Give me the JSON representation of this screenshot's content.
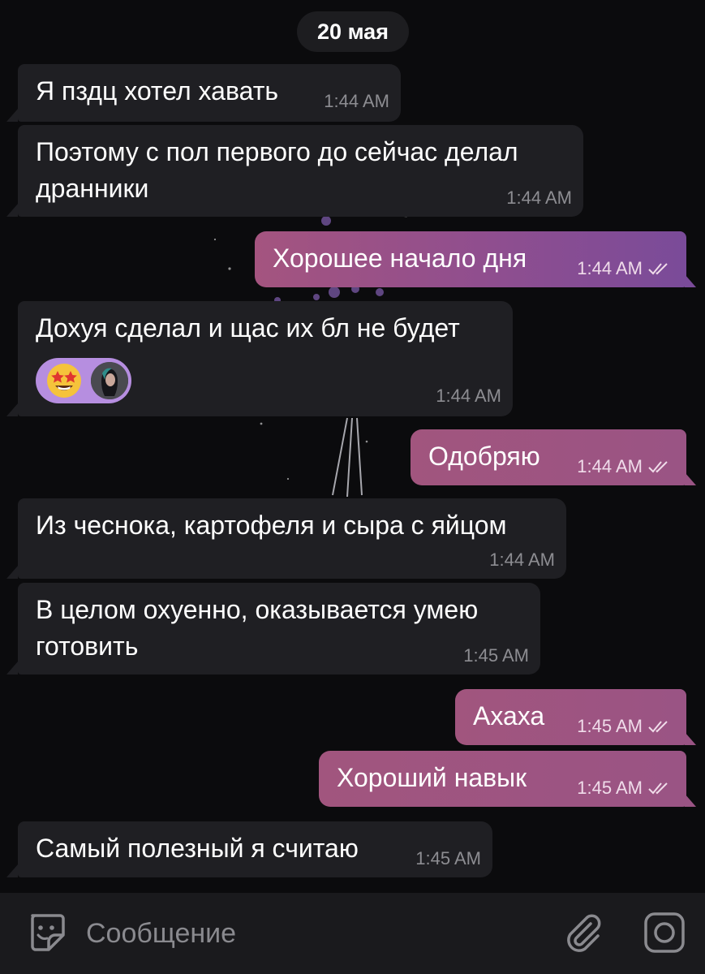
{
  "date_separator": "20 мая",
  "messages": [
    {
      "direction": "in",
      "lines": [
        "Я пздц хотел хавать"
      ],
      "time": "1:44 AM"
    },
    {
      "direction": "in",
      "lines": [
        "Поэтому с пол первого до сейчас делал",
        "дранники"
      ],
      "time": "1:44 AM"
    },
    {
      "direction": "out",
      "lines": [
        "Хорошее начало дня"
      ],
      "time": "1:44 AM",
      "status": "read"
    },
    {
      "direction": "in",
      "lines": [
        "Дохуя сделал и щас их бл не будет"
      ],
      "time": "1:44 AM",
      "reaction": {
        "emoji": "star-struck-emoji",
        "by": "user-avatar"
      }
    },
    {
      "direction": "out",
      "lines": [
        "Одобряю"
      ],
      "time": "1:44 AM",
      "status": "read"
    },
    {
      "direction": "in",
      "lines": [
        "Из чеснока, картофеля и сыра с яйцом"
      ],
      "time": "1:44 AM"
    },
    {
      "direction": "in",
      "lines": [
        "В целом охуенно, оказывается умею",
        "готовить"
      ],
      "time": "1:45 AM"
    },
    {
      "direction": "out",
      "lines": [
        "Ахаха"
      ],
      "time": "1:45 AM",
      "status": "read"
    },
    {
      "direction": "out",
      "lines": [
        "Хороший навык"
      ],
      "time": "1:45 AM",
      "status": "read"
    },
    {
      "direction": "in",
      "lines": [
        "Самый полезный я считаю"
      ],
      "time": "1:45 AM"
    }
  ],
  "composer": {
    "placeholder": "Сообщение",
    "left_icon": "sticker-icon",
    "right_icons": [
      "paperclip-icon",
      "camera-icon"
    ]
  },
  "colors": {
    "background": "#0b0b0d",
    "incoming_bubble": "#1f1f23",
    "outgoing_bubble_start": "#a4547f",
    "outgoing_bubble_end": "#7a4b99",
    "reaction_pill": "#b68ee0",
    "composer_bar": "#1a1a1d"
  }
}
